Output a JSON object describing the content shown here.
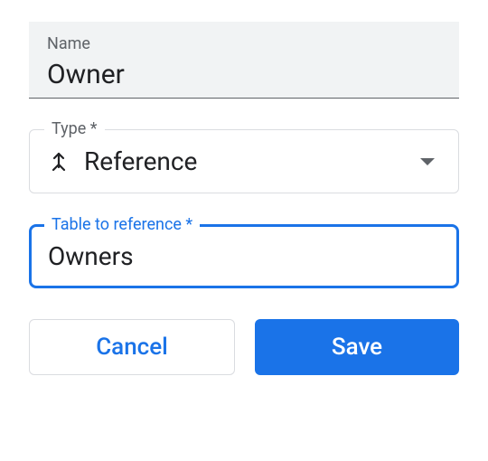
{
  "nameField": {
    "label": "Name",
    "value": "Owner"
  },
  "typeField": {
    "label": "Type *",
    "value": "Reference",
    "icon": "merge-icon"
  },
  "referenceField": {
    "label": "Table to reference *",
    "value": "Owners"
  },
  "buttons": {
    "cancel": "Cancel",
    "save": "Save"
  }
}
